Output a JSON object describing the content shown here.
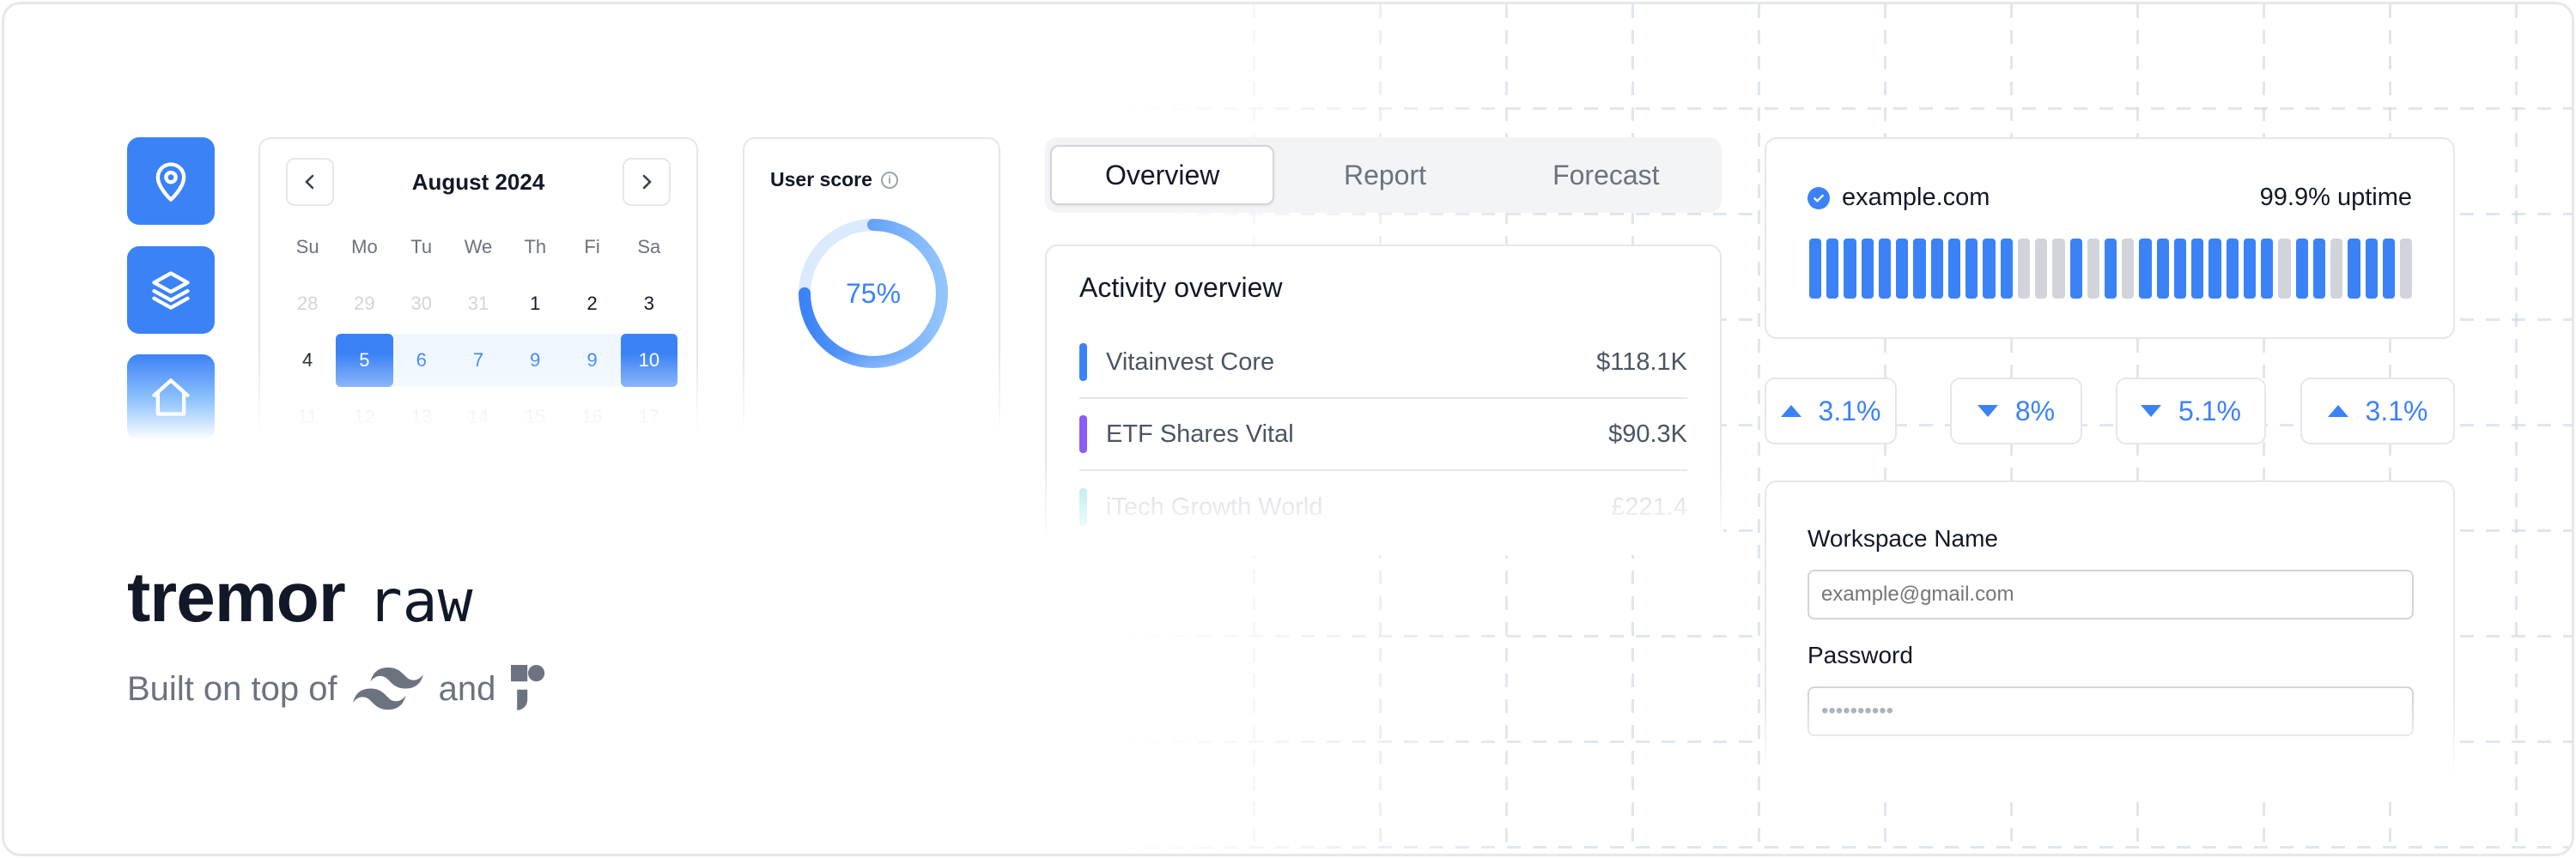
{
  "calendar": {
    "month_label": "August 2024",
    "weekdays": [
      "Su",
      "Mo",
      "Tu",
      "We",
      "Th",
      "Fi",
      "Sa"
    ],
    "weeks": [
      [
        "28",
        "29",
        "30",
        "31",
        "1",
        "2",
        "3"
      ],
      [
        "4",
        "5",
        "6",
        "7",
        "9",
        "9",
        "10"
      ],
      [
        "11",
        "12",
        "13",
        "14",
        "15",
        "16",
        "17"
      ]
    ],
    "selected_start": "5",
    "selected_end": "10"
  },
  "user_score": {
    "title": "User score",
    "value_label": "75%",
    "value": 0.75
  },
  "tabs": {
    "items": [
      "Overview",
      "Report",
      "Forecast"
    ],
    "active": "Overview"
  },
  "activity": {
    "title": "Activity overview",
    "items": [
      {
        "name": "Vitainvest Core",
        "value": "$118.1K",
        "color": "#3b82f6"
      },
      {
        "name": "ETF Shares Vital",
        "value": "$90.3K",
        "color": "#8b5cf6"
      },
      {
        "name": "iTech Growth World",
        "value": "£221.4",
        "color": "#22d3ee"
      }
    ]
  },
  "uptime": {
    "domain": "example.com",
    "uptime_label": "99.9% uptime",
    "bars": [
      "up",
      "up",
      "up",
      "up",
      "up",
      "up",
      "up",
      "up",
      "up",
      "up",
      "up",
      "up",
      "down",
      "down",
      "down",
      "up",
      "down",
      "up",
      "down",
      "up",
      "up",
      "up",
      "up",
      "up",
      "up",
      "up",
      "up",
      "down",
      "up",
      "up",
      "down",
      "up",
      "up",
      "up",
      "down"
    ],
    "colors": {
      "up": "#3b82f6",
      "down": "#d1d5db"
    }
  },
  "badges": [
    {
      "label": "3.1%",
      "direction": "up"
    },
    {
      "label": "8%",
      "direction": "down"
    },
    {
      "label": "5.1%",
      "direction": "down"
    },
    {
      "label": "3.1%",
      "direction": "up"
    }
  ],
  "form": {
    "workspace_label": "Workspace Name",
    "workspace_placeholder": "example@gmail.com",
    "password_label": "Password",
    "password_value": "••••••••••"
  },
  "brand": {
    "name": "tremor",
    "suffix": "raw",
    "built_on_prefix": "Built on top of",
    "built_on_and": "and",
    "tech_icons": [
      "tailwind-icon",
      "radix-icon"
    ]
  },
  "sidebar_icons": [
    "map-pin-icon",
    "layers-icon",
    "home-icon"
  ],
  "accent_color": "#3b82f6"
}
